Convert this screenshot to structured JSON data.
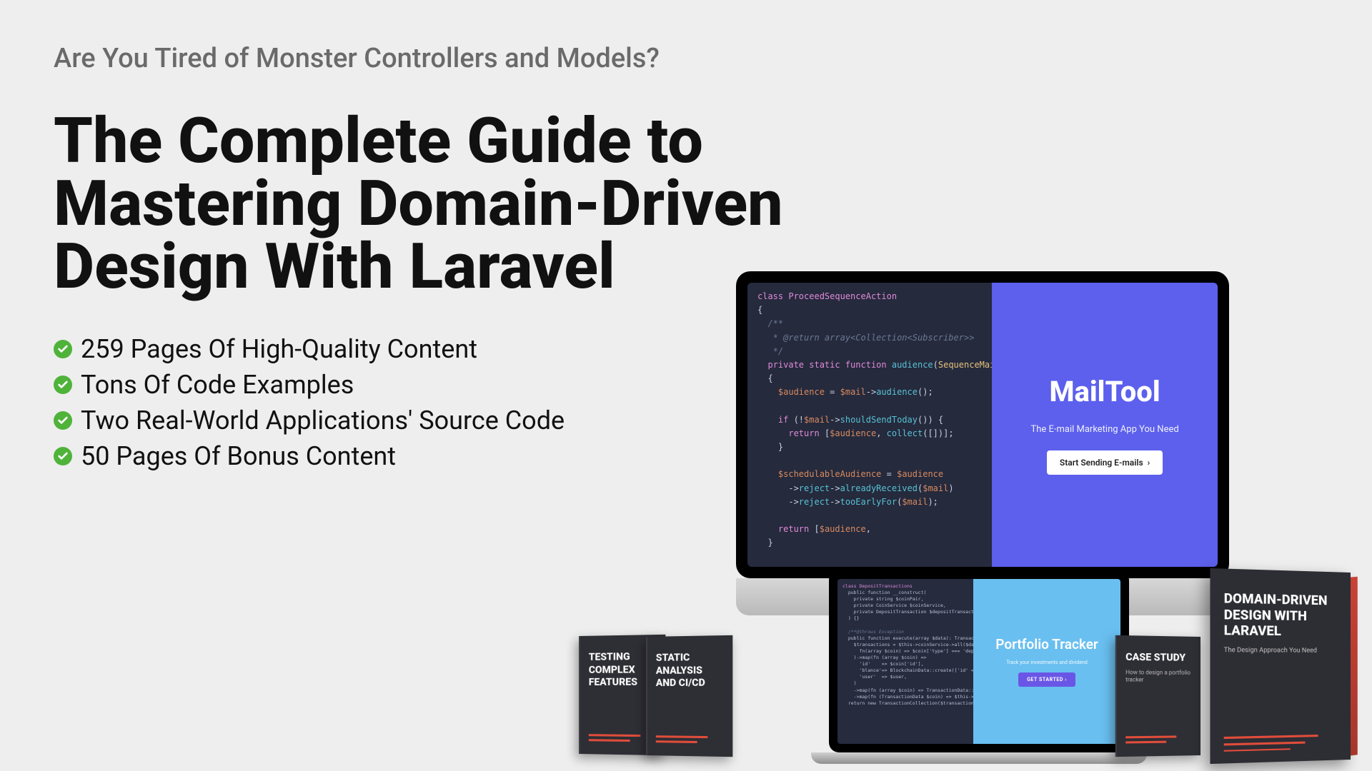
{
  "hero": {
    "subtitle": "Are You Tired of Monster Controllers and Models?",
    "title": "The Complete Guide to Mastering Domain-Driven Design With Laravel",
    "features": [
      "259 Pages Of High-Quality Content",
      "Tons Of Code Examples",
      "Two Real-World Applications' Source Code",
      "50 Pages Of Bonus Content"
    ]
  },
  "mailtool": {
    "logo": "MailTool",
    "tagline": "The E-mail Marketing App You Need",
    "cta": "Start Sending E-mails"
  },
  "portfolio": {
    "logo": "Portfolio Tracker",
    "tagline": "Track your investments and dividend",
    "cta": "GET STARTED ›"
  },
  "imac_code": {
    "l1": "class ProceedSequenceAction",
    "l2": "{",
    "l3": "  /**",
    "l4": "   * @return array<Collection<Subscriber>>",
    "l5": "   */",
    "l6": "  private static function audience(SequenceMail $mail)",
    "l7": "  {",
    "l8": "    $audience = $mail->audience();",
    "l9": "",
    "l10": "    if (!$mail->shouldSendToday()) {",
    "l11": "      return [$audience, collect([])];",
    "l12": "    }",
    "l13": "",
    "l14": "    $schedulableAudience = $audience",
    "l15": "      ->reject->alreadyReceived($mail)",
    "l16": "      ->reject->tooEarlyFor($mail);",
    "l17": "",
    "l18": "    return [$audience,",
    "l19": "  }"
  },
  "mb_code": {
    "l1": "class DepositTransactions",
    "l2": "  public function __construct(",
    "l3": "    private string $coinPair,",
    "l4": "    private CoinService $coinService,",
    "l5": "    private DepositTransaction $depositTransaction,",
    "l6": "  ) {}",
    "l7": "",
    "l8": "  /**@throws Exception",
    "l9": "  public function execute(array $data): TransactionCollect",
    "l10": "    $transactions = $this->coinService->all($data->map(",
    "l11": "      fn(array $coin) => $coin['type'] === 'deposit'",
    "l12": "    )->map(fn (array $coin) =>",
    "l13": "      'id'    => $coin['id'],",
    "l14": "      'blance'=> BlockchainData::create(['id' => $coin",
    "l15": "      'user'  => $user,",
    "l16": "    )",
    "l17": "    ->map(fn (array $coin) => TransactionData::make($coin",
    "l18": "    ->map(fn (TransactionData $coin) => $this->execute",
    "l19": "  return new TransactionCollection($transactions);"
  },
  "books": {
    "b1": {
      "title": "TESTING COMPLEX FEATURES"
    },
    "b2": {
      "title": "STATIC ANALYSIS AND CI/CD"
    },
    "b3": {
      "title": "CASE STUDY",
      "subtitle": "How to design a portfolio tracker"
    },
    "big": {
      "title": "DOMAIN-DRIVEN DESIGN WITH LARAVEL",
      "subtitle": "The Design Approach You Need"
    }
  }
}
